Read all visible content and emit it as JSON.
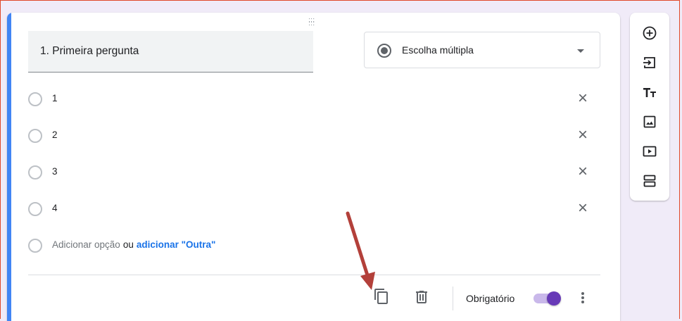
{
  "question": {
    "title": "1. Primeira pergunta",
    "type_label": "Escolha múltipla",
    "options": [
      "1",
      "2",
      "3",
      "4"
    ],
    "add_option_label": "Adicionar opção",
    "or_label": "ou",
    "add_other_label": "adicionar \"Outra\""
  },
  "footer": {
    "required_label": "Obrigatório",
    "required_on": true
  },
  "icons": {
    "drag": "drag-handle-icon",
    "remove": "close-icon",
    "copy": "content-copy-icon",
    "delete": "trash-icon",
    "more": "more-vert-icon",
    "toolbar": [
      "add-circle-icon",
      "import-question-icon",
      "title-text-icon",
      "image-icon",
      "video-icon",
      "section-icon"
    ]
  },
  "colors": {
    "accent": "#4285f4",
    "toggle": "#673ab7",
    "link": "#1a73e8",
    "page_bg": "#f0ebf8",
    "annotation_arrow": "#b3403a"
  }
}
